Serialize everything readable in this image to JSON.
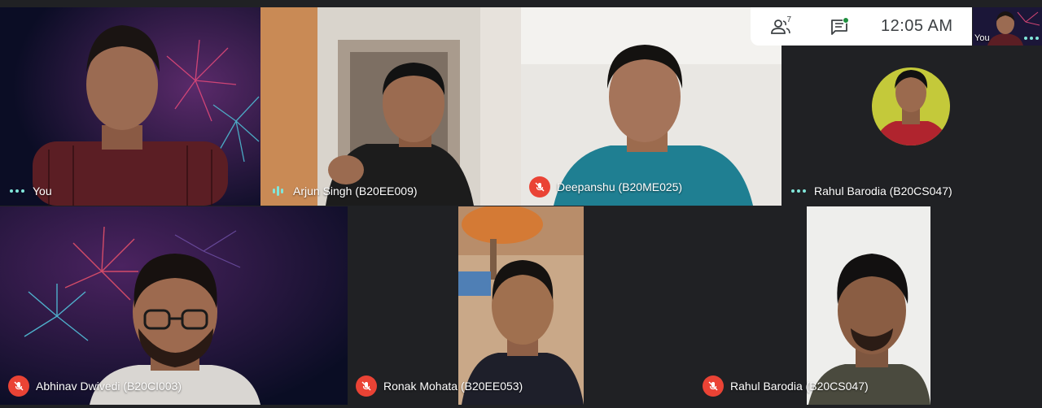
{
  "top_bar": {
    "people_count": "7",
    "time": "12:05  AM",
    "self_label": "You"
  },
  "tiles": [
    {
      "name": "You",
      "status": "dots"
    },
    {
      "name": "Arjun Singh (B20EE009)",
      "status": "speaking"
    },
    {
      "name": "Deepanshu (B20ME025)",
      "status": "muted"
    },
    {
      "name": "Rahul Barodia (B20CS047)",
      "status": "dots"
    },
    {
      "name": "Abhinav Dwivedi (B20CI003)",
      "status": "muted"
    },
    {
      "name": "Ronak Mohata (B20EE053)",
      "status": "muted"
    },
    {
      "name": "Rahul Barodia (B20CS047)",
      "status": "muted"
    }
  ],
  "colors": {
    "background": "#202124",
    "muted_badge": "#ea4335",
    "speaking_indicator": "#81e6d9",
    "chat_notification": "#1e8e3e"
  }
}
